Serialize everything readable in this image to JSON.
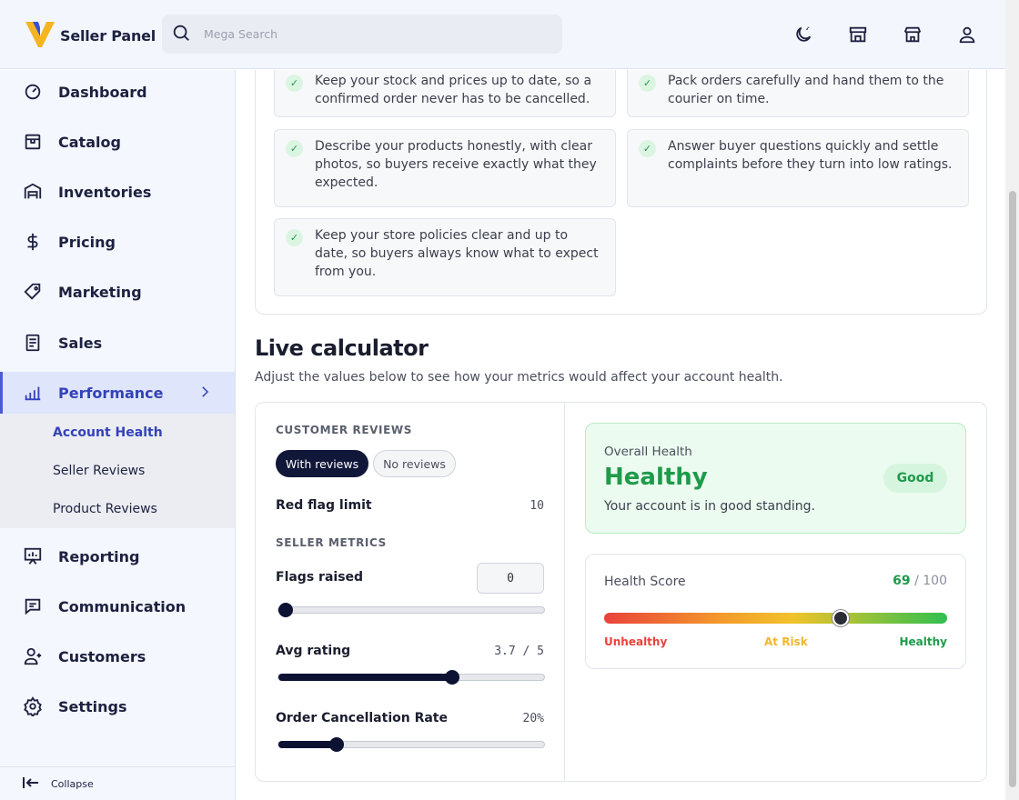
{
  "header": {
    "brand": "Seller Panel",
    "search_placeholder": "Mega Search",
    "icons": [
      "moon-icon",
      "store-icon",
      "shop-icon",
      "user-icon"
    ]
  },
  "sidebar": {
    "items": [
      {
        "label": "Dashboard",
        "icon": "dashboard-icon"
      },
      {
        "label": "Catalog",
        "icon": "catalog-icon"
      },
      {
        "label": "Inventories",
        "icon": "warehouse-icon"
      },
      {
        "label": "Pricing",
        "icon": "dollar-icon"
      },
      {
        "label": "Marketing",
        "icon": "tag-icon"
      },
      {
        "label": "Sales",
        "icon": "receipt-icon"
      },
      {
        "label": "Performance",
        "icon": "chart-icon",
        "active": true
      },
      {
        "label": "Reporting",
        "icon": "presentation-icon"
      },
      {
        "label": "Communication",
        "icon": "chat-icon"
      },
      {
        "label": "Customers",
        "icon": "users-icon"
      },
      {
        "label": "Settings",
        "icon": "gear-icon"
      }
    ],
    "sub_items": [
      "Account Health",
      "Seller Reviews",
      "Product Reviews"
    ],
    "collapse_label": "Collapse"
  },
  "rules": [
    "Keep your stock and prices up to date, so a confirmed order never has to be cancelled.",
    "Pack orders carefully and hand them to the courier on time.",
    "Describe your products honestly, with clear photos, so buyers receive exactly what they expected.",
    "Answer buyer questions quickly and settle complaints before they turn into low ratings.",
    "Keep your store policies clear and up to date, so buyers always know what to expect from you."
  ],
  "calculator": {
    "title": "Live calculator",
    "subtitle": "Adjust the values below to see how your metrics would affect your account health.",
    "customer_reviews_label": "CUSTOMER REVIEWS",
    "with_reviews": "With reviews",
    "no_reviews": "No reviews",
    "red_flag_label": "Red flag limit",
    "red_flag_value": "10",
    "seller_metrics_label": "SELLER METRICS",
    "flags_label": "Flags raised",
    "flags_value": "0",
    "flags_fraction": 0,
    "avg_rating_label": "Avg rating",
    "avg_rating_value": "3.7 / 5",
    "avg_rating_fraction": 0.66,
    "cancel_label": "Order Cancellation Rate",
    "cancel_value": "20%",
    "cancel_fraction": 0.2
  },
  "health": {
    "overall_label": "Overall Health",
    "status": "Healthy",
    "badge": "Good",
    "description": "Your account is in good standing.",
    "score_label": "Health Score",
    "score": "69",
    "score_max": "/ 100",
    "score_fraction": 0.69,
    "gauge_labels": [
      "Unhealthy",
      "At Risk",
      "Healthy"
    ],
    "colors": {
      "unhealthy": "#e8423b",
      "at_risk": "#f1b62b",
      "healthy": "#1f9a4a"
    }
  }
}
